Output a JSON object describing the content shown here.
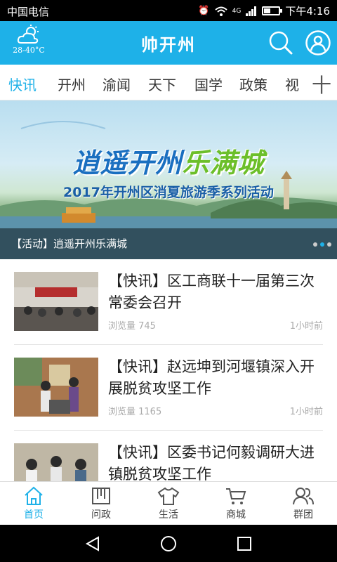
{
  "status": {
    "carrier": "中国电信",
    "time": "下午4:16",
    "net": "4G"
  },
  "header": {
    "title": "帅开州",
    "temperature": "28-40°C",
    "weather_icon": "cloud-sun-icon"
  },
  "tabs": [
    {
      "label": "快讯",
      "active": true
    },
    {
      "label": "开州"
    },
    {
      "label": "渝闻"
    },
    {
      "label": "天下"
    },
    {
      "label": "国学"
    },
    {
      "label": "政策"
    },
    {
      "label": "视"
    }
  ],
  "tabs_more": "十",
  "banner": {
    "headline_a": "逍遥开州",
    "headline_b": "乐满城",
    "subline": "2017年开州区消夏旅游季系列活动",
    "caption": "【活动】逍遥开州乐满城"
  },
  "news": [
    {
      "title": "【快讯】区工商联十一届第三次常委会召开",
      "views": "浏览量 745",
      "time": "1小时前"
    },
    {
      "title": "【快讯】赵远坤到河堰镇深入开展脱贫攻坚工作",
      "views": "浏览量 1165",
      "time": "1小时前"
    },
    {
      "title": "【快讯】区委书记何毅调研大进镇脱贫攻坚工作",
      "views": "",
      "time": ""
    }
  ],
  "bottom_nav": [
    {
      "label": "首页",
      "icon": "home-icon",
      "active": true
    },
    {
      "label": "问政",
      "icon": "book-icon"
    },
    {
      "label": "生活",
      "icon": "shirt-icon"
    },
    {
      "label": "商城",
      "icon": "cart-icon"
    },
    {
      "label": "群团",
      "icon": "people-icon"
    }
  ],
  "colors": {
    "accent": "#1eb1e8",
    "text": "#222222",
    "muted": "#aaaaaa"
  }
}
